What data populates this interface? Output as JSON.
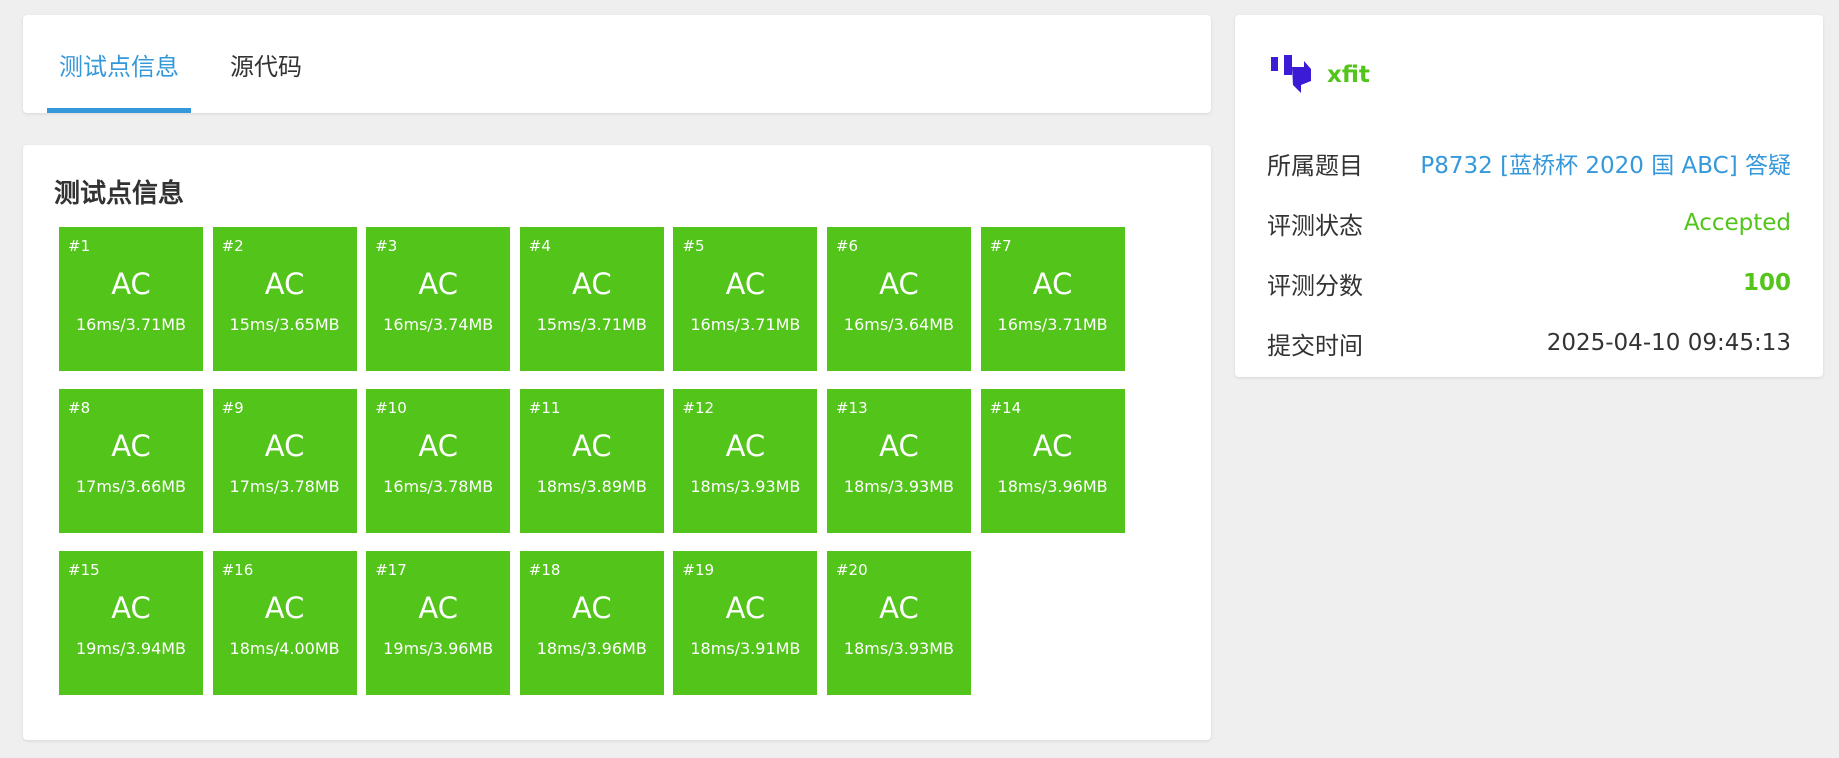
{
  "tabs": [
    {
      "label": "测试点信息",
      "active": true
    },
    {
      "label": "源代码",
      "active": false
    }
  ],
  "tests_section": {
    "title": "测试点信息",
    "pass_color": "#52c41a",
    "cases": [
      {
        "id": "#1",
        "status": "AC",
        "stats": "16ms/3.71MB"
      },
      {
        "id": "#2",
        "status": "AC",
        "stats": "15ms/3.65MB"
      },
      {
        "id": "#3",
        "status": "AC",
        "stats": "16ms/3.74MB"
      },
      {
        "id": "#4",
        "status": "AC",
        "stats": "15ms/3.71MB"
      },
      {
        "id": "#5",
        "status": "AC",
        "stats": "16ms/3.71MB"
      },
      {
        "id": "#6",
        "status": "AC",
        "stats": "16ms/3.64MB"
      },
      {
        "id": "#7",
        "status": "AC",
        "stats": "16ms/3.71MB"
      },
      {
        "id": "#8",
        "status": "AC",
        "stats": "17ms/3.66MB"
      },
      {
        "id": "#9",
        "status": "AC",
        "stats": "17ms/3.78MB"
      },
      {
        "id": "#10",
        "status": "AC",
        "stats": "16ms/3.78MB"
      },
      {
        "id": "#11",
        "status": "AC",
        "stats": "18ms/3.89MB"
      },
      {
        "id": "#12",
        "status": "AC",
        "stats": "18ms/3.93MB"
      },
      {
        "id": "#13",
        "status": "AC",
        "stats": "18ms/3.93MB"
      },
      {
        "id": "#14",
        "status": "AC",
        "stats": "18ms/3.96MB"
      },
      {
        "id": "#15",
        "status": "AC",
        "stats": "19ms/3.94MB"
      },
      {
        "id": "#16",
        "status": "AC",
        "stats": "18ms/4.00MB"
      },
      {
        "id": "#17",
        "status": "AC",
        "stats": "19ms/3.96MB"
      },
      {
        "id": "#18",
        "status": "AC",
        "stats": "18ms/3.96MB"
      },
      {
        "id": "#19",
        "status": "AC",
        "stats": "18ms/3.91MB"
      },
      {
        "id": "#20",
        "status": "AC",
        "stats": "18ms/3.93MB"
      }
    ]
  },
  "submission_info": {
    "user": {
      "name": "xfit",
      "avatar_icon": "avatar-logo-icon"
    },
    "problem_label": "所属题目",
    "problem_value": "P8732 [蓝桥杯 2020 国 ABC] 答疑",
    "status_label": "评测状态",
    "status_value": "Accepted",
    "score_label": "评测分数",
    "score_value": "100",
    "time_label": "提交时间",
    "time_value": "2025-04-10 09:45:13"
  },
  "colors": {
    "accent": "#3498db",
    "success": "#52c41a",
    "background": "#efefef",
    "text": "#333333"
  }
}
